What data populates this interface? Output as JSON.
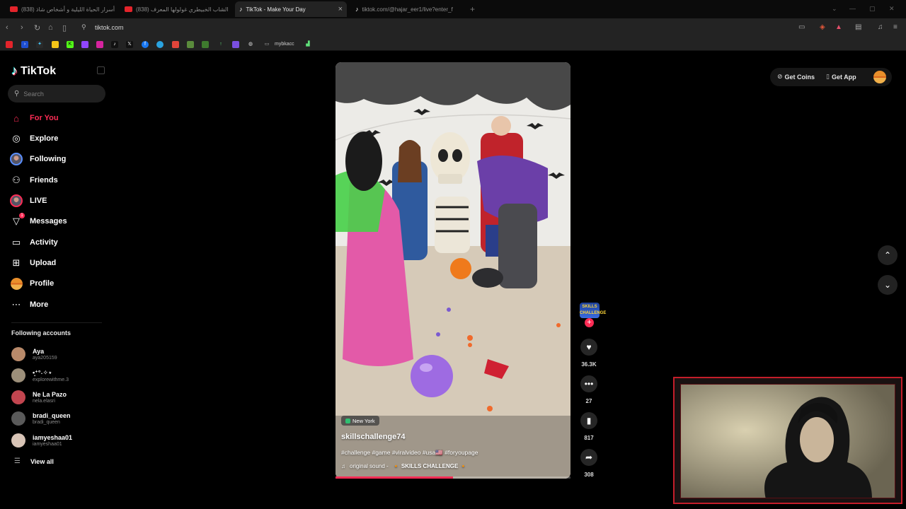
{
  "browser": {
    "tabs": [
      {
        "title": "(838) أسرار الحياة الليلية و أشخاص شاذ",
        "kind": "youtube",
        "active": false
      },
      {
        "title": "(838) الشاب الخبيطري غولولها المعرف",
        "kind": "youtube",
        "active": false
      },
      {
        "title": "TikTok - Make Your Day",
        "kind": "tiktok",
        "active": true
      },
      {
        "title": "tiktok.com/@hajar_eer1/live?enter_f",
        "kind": "tiktok",
        "active": false
      }
    ],
    "new_tab": "+",
    "close": "×",
    "url": "tiktok.com",
    "bookmark_folder": "mybkacc"
  },
  "tiktok": {
    "logo": "TikTok",
    "search_placeholder": "Search",
    "nav": [
      {
        "label": "For You",
        "icon": "home-icon",
        "active": true
      },
      {
        "label": "Explore",
        "icon": "compass-icon",
        "active": false
      },
      {
        "label": "Following",
        "icon": "following-avatar-icon",
        "active": false
      },
      {
        "label": "Friends",
        "icon": "friends-icon",
        "active": false
      },
      {
        "label": "LIVE",
        "icon": "live-avatar-icon",
        "active": false
      },
      {
        "label": "Messages",
        "icon": "messages-icon",
        "active": false,
        "badge": "1"
      },
      {
        "label": "Activity",
        "icon": "activity-icon",
        "active": false
      },
      {
        "label": "Upload",
        "icon": "upload-icon",
        "active": false
      },
      {
        "label": "Profile",
        "icon": "profile-avatar-icon",
        "active": false
      },
      {
        "label": "More",
        "icon": "more-icon",
        "active": false
      }
    ],
    "following_title": "Following accounts",
    "accounts": [
      {
        "name": "Aya",
        "handle": "aya205159",
        "color": "#b98a6a"
      },
      {
        "name": "•̩͙⁺°˖✧⋆",
        "handle": "explorewithme.3",
        "color": "#9c8f7a"
      },
      {
        "name": "Ne La Pazo",
        "handle": "nela.elasri",
        "color": "#c2454f"
      },
      {
        "name": "bradi_queen",
        "handle": "bradi_queen",
        "color": "#5a5a5a"
      },
      {
        "name": "iamyeshaa01",
        "handle": "iamyeshaa01",
        "color": "#d8c4b6"
      }
    ],
    "view_all": "View all",
    "top_right": {
      "coins": "Get Coins",
      "app": "Get App"
    },
    "video": {
      "location": "New York",
      "author": "skillschallenge74",
      "description": "#challenge #game #viralvideo #usa🇺🇸 #foryoupage",
      "music_prefix": "original sound -",
      "music_title": "🔸 SKILLS CHALLENGE 🔸",
      "progress": 0.5,
      "creator_badge": "SKILLS CHALLENGE"
    },
    "actions": {
      "likes": "36.3K",
      "comments": "27",
      "saves": "817",
      "shares": "308"
    }
  }
}
